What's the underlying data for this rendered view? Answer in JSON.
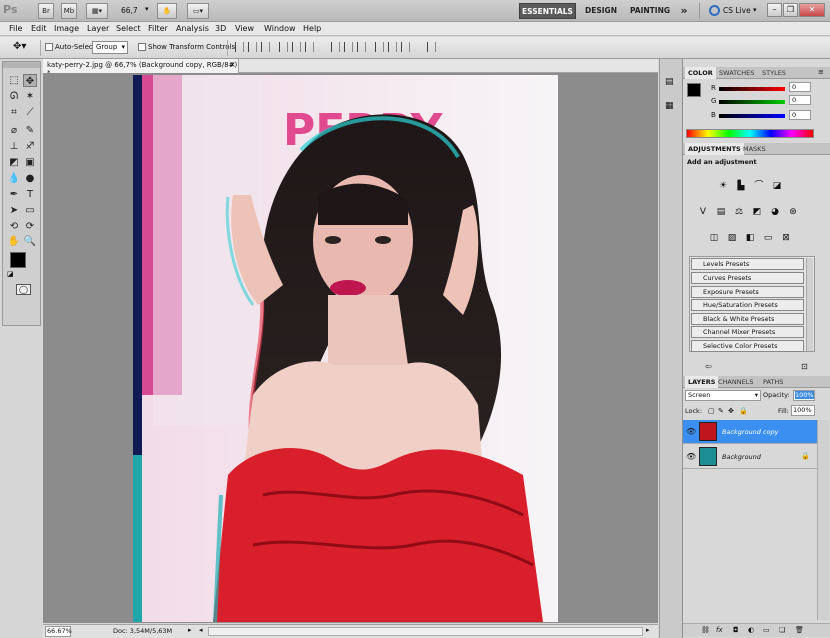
{
  "appbar": {
    "logo": "Ps",
    "br": "Br",
    "mb": "Mb",
    "zoom": "66,7",
    "workspaces": [
      "ESSENTIALS",
      "DESIGN",
      "PAINTING"
    ],
    "more": "»",
    "cslive": "CS Live"
  },
  "menu": [
    "File",
    "Edit",
    "Image",
    "Layer",
    "Select",
    "Filter",
    "Analysis",
    "3D",
    "View",
    "Window",
    "Help"
  ],
  "options": {
    "auto_select_label": "Auto-Select:",
    "auto_select_value": "Group",
    "transform_label": "Show Transform Controls"
  },
  "document": {
    "tab_title": "katy-perry-2.jpg @ 66,7% (Background copy, RGB/8#) *",
    "zoom_status": "66.67%",
    "doc_info": "Doc: 3,54M/5,63M"
  },
  "color_panel": {
    "tabs": [
      "COLOR",
      "SWATCHES",
      "STYLES"
    ],
    "channels": [
      {
        "name": "R",
        "value": "0"
      },
      {
        "name": "G",
        "value": "0"
      },
      {
        "name": "B",
        "value": "0"
      }
    ]
  },
  "adjustments_panel": {
    "tabs": [
      "ADJUSTMENTS",
      "MASKS"
    ],
    "heading": "Add an adjustment",
    "presets": [
      "Levels Presets",
      "Curves Presets",
      "Exposure Presets",
      "Hue/Saturation Presets",
      "Black & White Presets",
      "Channel Mixer Presets",
      "Selective Color Presets"
    ]
  },
  "layers_panel": {
    "tabs": [
      "LAYERS",
      "CHANNELS",
      "PATHS"
    ],
    "blend_mode": "Screen",
    "opacity_label": "Opacity:",
    "opacity_value": "100%",
    "lock_label": "Lock:",
    "fill_label": "Fill:",
    "fill_value": "100%",
    "layers": [
      {
        "name": "Background copy",
        "selected": true
      },
      {
        "name": "Background",
        "selected": false
      }
    ]
  },
  "photo_text": "PERRY"
}
